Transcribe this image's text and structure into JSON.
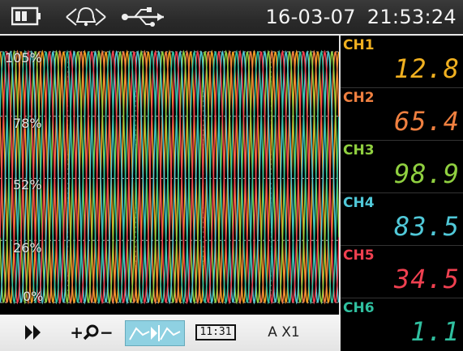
{
  "status_bar": {
    "battery_icon": "battery-icon",
    "alarm_icon": "alarm-bell-icon",
    "usb_icon": "usb-icon",
    "date": "16-03-07",
    "time": "21:53:24"
  },
  "chart": {
    "y_axis_labels": [
      "105%",
      "78%",
      "52%",
      "26%",
      "0%"
    ]
  },
  "chart_data": {
    "type": "line",
    "title": "",
    "xlabel": "",
    "ylabel": "",
    "ylim": [
      0,
      105
    ],
    "yticks": [
      0,
      26,
      52,
      78,
      105
    ],
    "grid": true,
    "series": [
      {
        "color": "#f0a020",
        "amplitude_min": 0,
        "amplitude_max": 105,
        "periods": 16,
        "phase": 0.0
      },
      {
        "color": "#f08040",
        "amplitude_min": 0,
        "amplitude_max": 105,
        "periods": 16,
        "phase": 0.17
      },
      {
        "color": "#90d040",
        "amplitude_min": 0,
        "amplitude_max": 105,
        "periods": 16,
        "phase": 0.33
      },
      {
        "color": "#50c8d0",
        "amplitude_min": 0,
        "amplitude_max": 105,
        "periods": 16,
        "phase": 0.5
      },
      {
        "color": "#f04050",
        "amplitude_min": 0,
        "amplitude_max": 105,
        "periods": 16,
        "phase": 0.67
      },
      {
        "color": "#30c0a0",
        "amplitude_min": 0,
        "amplitude_max": 105,
        "periods": 16,
        "phase": 0.83
      }
    ]
  },
  "toolbar": {
    "play_icon": "fast-forward-icon",
    "zoom_icon": "zoom-icon",
    "zoom_plus": "+",
    "zoom_minus": "−",
    "wave_mode_icon": "waveform-mode-icon",
    "clock_label": "11:31",
    "scale_label": "A X1"
  },
  "channels": [
    {
      "label": "CH1",
      "value": "12.8",
      "label_color": "#f0b020",
      "value_color": "#f0b020"
    },
    {
      "label": "CH2",
      "value": "65.4",
      "label_color": "#f08040",
      "value_color": "#f08040"
    },
    {
      "label": "CH3",
      "value": "98.9",
      "label_color": "#90d040",
      "value_color": "#90d040"
    },
    {
      "label": "CH4",
      "value": "83.5",
      "label_color": "#50c8d8",
      "value_color": "#50c8d8"
    },
    {
      "label": "CH5",
      "value": "34.5",
      "label_color": "#f04050",
      "value_color": "#f04050"
    },
    {
      "label": "CH6",
      "value": "1.1",
      "label_color": "#30c0a0",
      "value_color": "#30c0a0"
    }
  ]
}
